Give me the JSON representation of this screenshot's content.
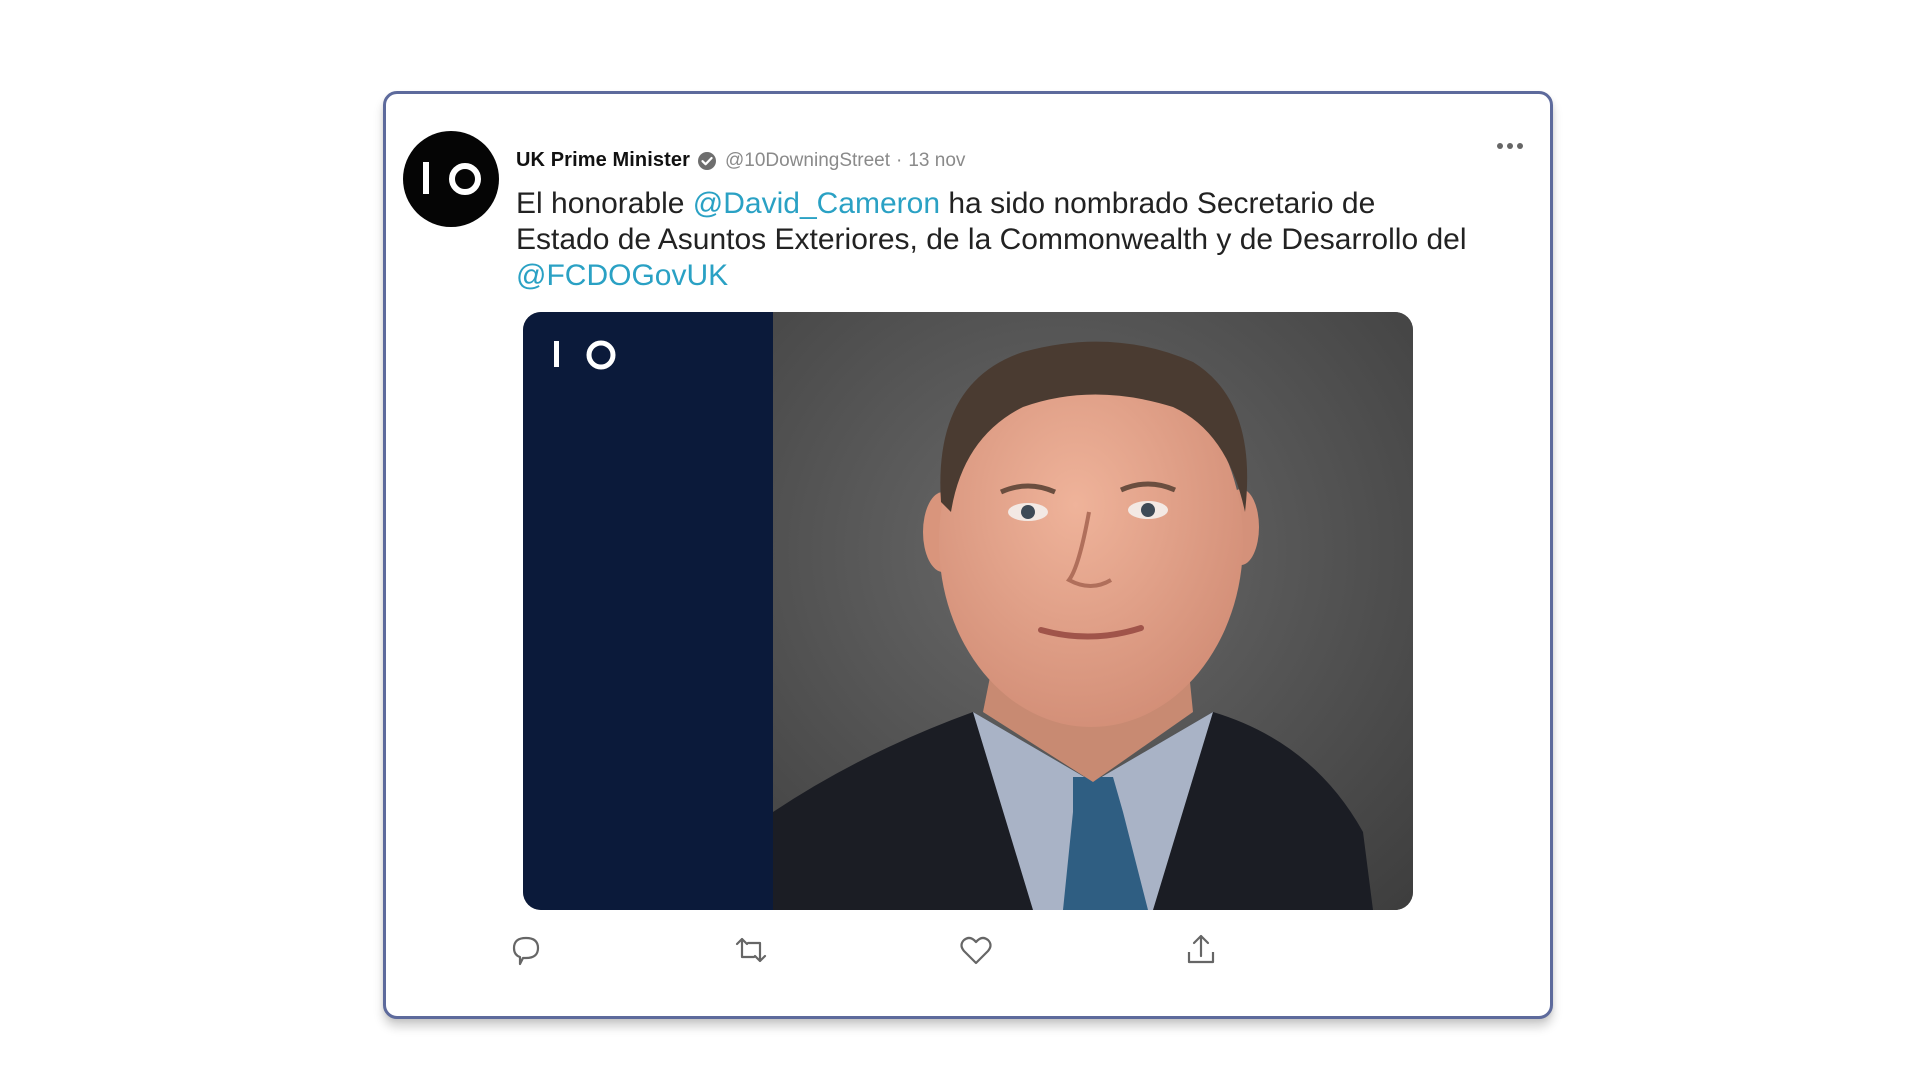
{
  "tweet": {
    "display_name": "UK Prime Minister",
    "handle": "@10DowningStreet",
    "separator": "·",
    "date": "13 nov",
    "text_parts": {
      "p1": "El honorable ",
      "m1": "@David_Cameron",
      "p2": " ha sido nombrado Secretario de Estado de Asuntos Exteriores, de la Commonwealth y de Desarrollo del ",
      "m2": "@FCDOGovUK"
    },
    "avatar_logo": "10",
    "media_logo": "10",
    "colors": {
      "mention": "#2aa1c4",
      "card_border": "#5d6a9c",
      "media_panel": "#0b1a3a"
    },
    "icons": [
      "verified-badge-icon",
      "more-options-icon",
      "reply-icon",
      "retweet-icon",
      "like-icon",
      "share-icon"
    ]
  }
}
